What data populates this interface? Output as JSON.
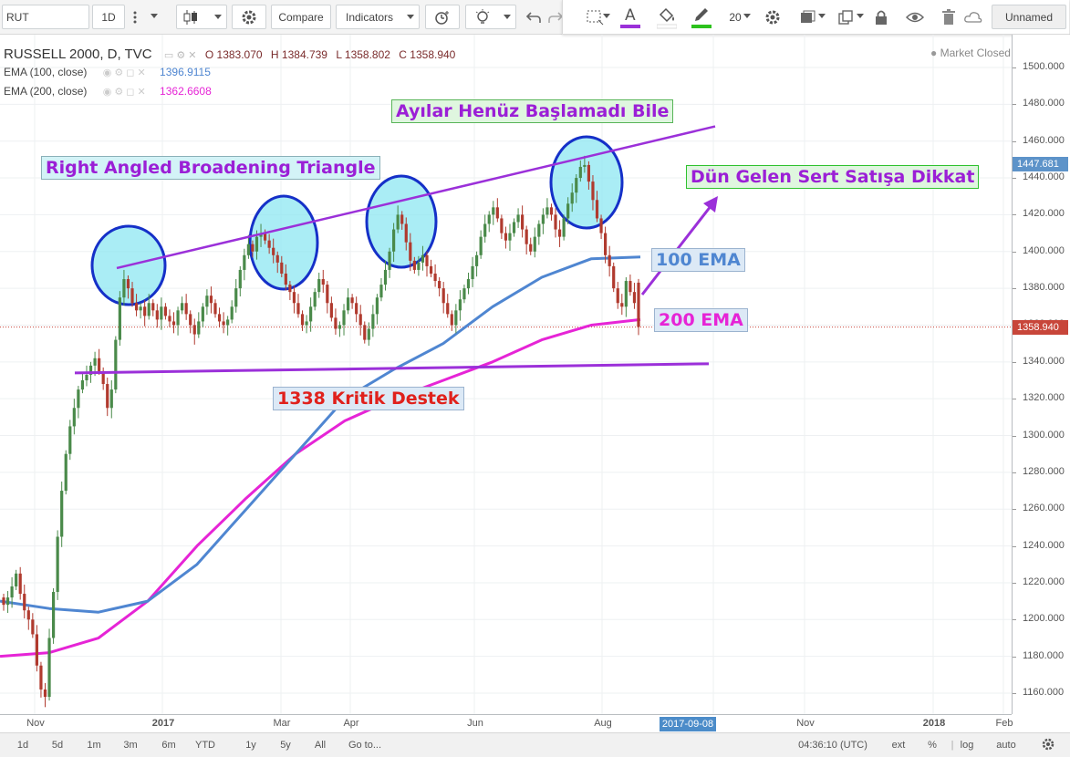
{
  "toolbar": {
    "symbol": "RUT",
    "interval": "1D",
    "compare_label": "Compare",
    "indicators_label": "Indicators",
    "line_width": "20",
    "layout_name": "Unnamed"
  },
  "legend": {
    "title": "RUSSELL 2000, D, TVC",
    "open": "O 1383.070",
    "high": "H 1384.739",
    "low": "L 1358.802",
    "close": "C 1358.940",
    "ema100_name": "EMA (100, close)",
    "ema100_value": "1396.9115",
    "ema200_name": "EMA (200, close)",
    "ema200_value": "1362.6608",
    "market_status": "Market Closed"
  },
  "price_scale": {
    "ticks": [
      "1500.000",
      "1480.000",
      "1460.000",
      "1440.000",
      "1420.000",
      "1400.000",
      "1380.000",
      "1360.000",
      "1340.000",
      "1320.000",
      "1300.000",
      "1280.000",
      "1260.000",
      "1240.000",
      "1220.000",
      "1200.000",
      "1180.000",
      "1160.000"
    ],
    "last_price_label": "1447.681",
    "current_price_label": "1358.940"
  },
  "time_scale": {
    "labels": [
      "Nov",
      "2017",
      "Mar",
      "Apr",
      "Jun",
      "Aug",
      "Nov",
      "2018",
      "Feb"
    ],
    "cursor_date": "2017-09-08"
  },
  "annotations": {
    "title_top": "Ayılar Henüz Başlamadı Bile",
    "triangle": "Right Angled Broadening Triangle",
    "warning": "Dün Gelen Sert Satışa Dikkat",
    "ema100": "100 EMA",
    "ema200": "200 EMA",
    "support": "1338 Kritik Destek"
  },
  "bottom_bar": {
    "ranges": [
      "1d",
      "5d",
      "1m",
      "3m",
      "6m",
      "YTD",
      "1y",
      "5y",
      "All"
    ],
    "goto": "Go to...",
    "clock": "04:36:10 (UTC)",
    "ext": "ext",
    "percent": "%",
    "log": "log",
    "auto": "auto"
  },
  "colors": {
    "up": "#4a8a4a",
    "down": "#b03a2e",
    "ema100": "#4f86d1",
    "ema200": "#e624d6",
    "trend": "#9b30d9",
    "circle_fill": "#8ee7f2",
    "circle_stroke": "#1530c8",
    "price_red": "#c8463a"
  },
  "chart_data": {
    "type": "candlestick",
    "instrument": "RUSSELL 2000",
    "timeframe": "D",
    "source": "TVC",
    "ylim": [
      1150,
      1510
    ],
    "last_ohlc": {
      "open": 1383.07,
      "high": 1384.739,
      "low": 1358.802,
      "close": 1358.94
    },
    "ema100_last": 1396.9115,
    "ema200_last": 1362.6608,
    "approx_closes": [
      1208,
      1212,
      1218,
      1225,
      1214,
      1205,
      1200,
      1192,
      1175,
      1162,
      1158,
      1190,
      1215,
      1245,
      1270,
      1290,
      1305,
      1315,
      1325,
      1330,
      1333,
      1338,
      1342,
      1335,
      1328,
      1315,
      1325,
      1352,
      1375,
      1385,
      1380,
      1372,
      1368,
      1370,
      1365,
      1372,
      1368,
      1363,
      1370,
      1365,
      1362,
      1360,
      1368,
      1372,
      1366,
      1360,
      1355,
      1362,
      1370,
      1376,
      1372,
      1366,
      1362,
      1360,
      1363,
      1370,
      1380,
      1390,
      1398,
      1404,
      1400,
      1408,
      1410,
      1406,
      1402,
      1398,
      1394,
      1388,
      1382,
      1378,
      1372,
      1366,
      1360,
      1362,
      1370,
      1378,
      1385,
      1382,
      1372,
      1364,
      1358,
      1360,
      1368,
      1375,
      1372,
      1366,
      1360,
      1352,
      1358,
      1366,
      1375,
      1382,
      1390,
      1400,
      1412,
      1420,
      1415,
      1405,
      1395,
      1390,
      1394,
      1398,
      1392,
      1388,
      1384,
      1380,
      1372,
      1366,
      1360,
      1368,
      1374,
      1380,
      1385,
      1392,
      1398,
      1408,
      1415,
      1420,
      1424,
      1418,
      1410,
      1406,
      1410,
      1416,
      1420,
      1412,
      1404,
      1400,
      1408,
      1415,
      1420,
      1424,
      1420,
      1412,
      1408,
      1418,
      1426,
      1432,
      1440,
      1446,
      1447,
      1438,
      1428,
      1418,
      1410,
      1398,
      1392,
      1380,
      1372,
      1370,
      1384,
      1378,
      1372,
      1359
    ],
    "ema100_approx": [
      1210,
      1206,
      1204,
      1210,
      1230,
      1260,
      1290,
      1320,
      1336,
      1350,
      1370,
      1386,
      1396,
      1397
    ],
    "ema200_approx": [
      1180,
      1182,
      1190,
      1210,
      1240,
      1266,
      1290,
      1308,
      1320,
      1330,
      1340,
      1352,
      1360,
      1363
    ],
    "trendlines": [
      {
        "name": "upper",
        "from": 1391,
        "to": 1468
      },
      {
        "name": "support",
        "from": 1334,
        "to": 1339
      }
    ]
  }
}
